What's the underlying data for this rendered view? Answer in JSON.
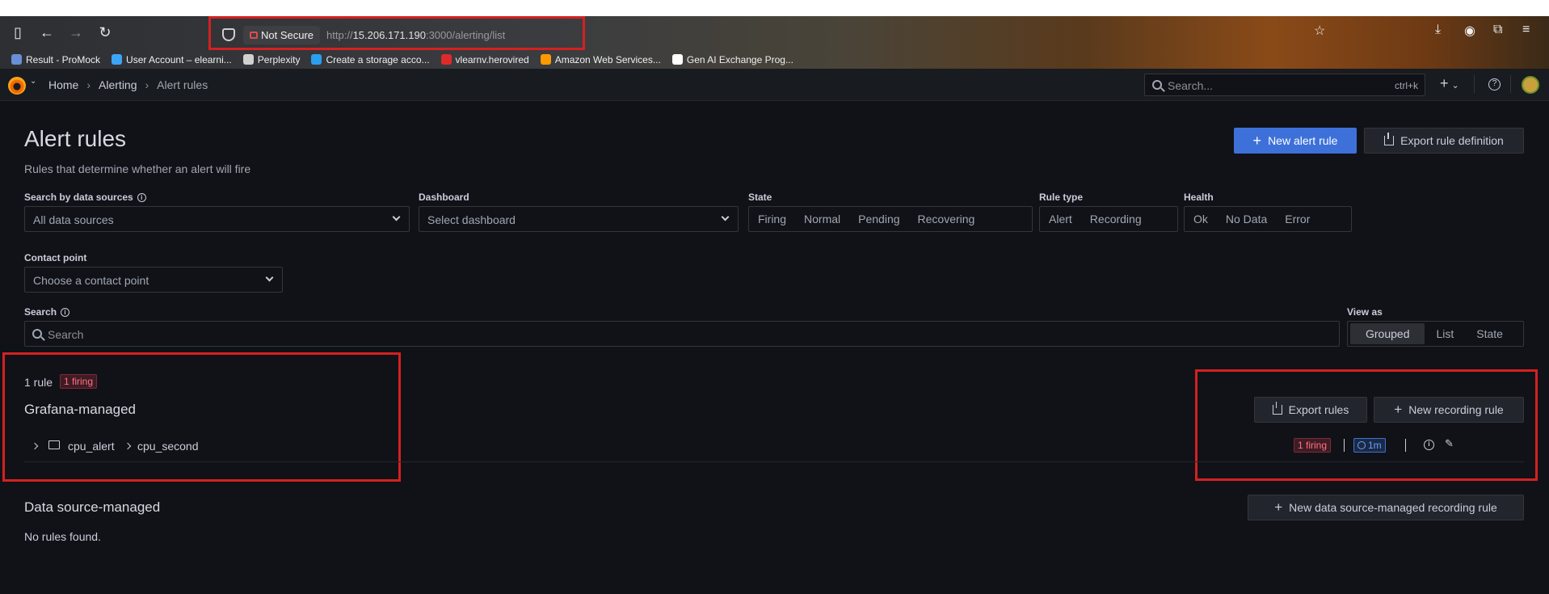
{
  "browser": {
    "not_secure_label": "Not Secure",
    "url_prefix": "http://",
    "url_host": "15.206.171.190",
    "url_path": ":3000/alerting/list",
    "bookmarks": [
      {
        "label": "Result - ProMock",
        "color": "#6b8fd6"
      },
      {
        "label": "User Account – elearni...",
        "color": "#3da5f5"
      },
      {
        "label": "Perplexity",
        "color": "#d0d0d0"
      },
      {
        "label": "Create a storage acco...",
        "color": "#2a9ff0"
      },
      {
        "label": "vlearnv.herovired",
        "color": "#e02a2a"
      },
      {
        "label": "Amazon Web Services...",
        "color": "#ff9900"
      },
      {
        "label": "Gen AI Exchange Prog...",
        "color": "#ffffff"
      }
    ]
  },
  "topbar": {
    "breadcrumbs": [
      "Home",
      "Alerting",
      "Alert rules"
    ],
    "search_placeholder": "Search...",
    "search_shortcut": "ctrl+k",
    "add_label": "+"
  },
  "page": {
    "title": "Alert rules",
    "subtitle": "Rules that determine whether an alert will fire",
    "new_alert_rule": "New alert rule",
    "export_rule_definition": "Export rule definition"
  },
  "filters": {
    "datasource_label": "Search by data sources",
    "datasource_placeholder": "All data sources",
    "dashboard_label": "Dashboard",
    "dashboard_placeholder": "Select dashboard",
    "state_label": "State",
    "state_options": [
      "Firing",
      "Normal",
      "Pending",
      "Recovering"
    ],
    "rule_type_label": "Rule type",
    "rule_type_options": [
      "Alert",
      "Recording"
    ],
    "health_label": "Health",
    "health_options": [
      "Ok",
      "No Data",
      "Error"
    ],
    "contact_label": "Contact point",
    "contact_placeholder": "Choose a contact point",
    "search_label": "Search",
    "search_placeholder": "Search",
    "view_label": "View as",
    "view_options": [
      "Grouped",
      "List",
      "State"
    ],
    "view_selected": "Grouped"
  },
  "grafana_managed": {
    "rule_count": "1 rule",
    "firing_badge": "1 firing",
    "title": "Grafana-managed",
    "folder": "cpu_alert",
    "group": "cpu_second",
    "group_firing": "1 firing",
    "interval": "1m",
    "export_rules": "Export rules",
    "new_recording_rule": "New recording rule"
  },
  "datasource_managed": {
    "title": "Data source-managed",
    "empty": "No rules found.",
    "new_button": "New data source-managed recording rule"
  },
  "colors": {
    "primary": "#3d71d9",
    "firing": "#ff7383",
    "highlight": "#d42121"
  }
}
